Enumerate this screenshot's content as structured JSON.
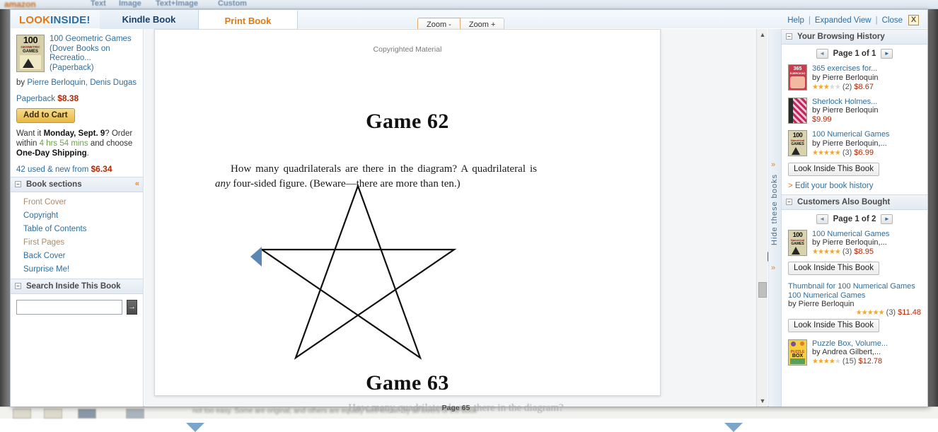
{
  "background": {
    "logo": "amazon",
    "nav": [
      "Text",
      "Image",
      "Text+Image",
      "Custom"
    ],
    "bottom_faded_text": "not too easy. Some are original, and others are equally well-known by all lovers of the book",
    "faded_page_text": "How many quadrilaterals are there in the diagram?"
  },
  "header": {
    "brand_look": "LOOK",
    "brand_inside": "INSIDE!",
    "tabs": [
      {
        "label": "Kindle Book",
        "active": false
      },
      {
        "label": "Print Book",
        "active": true
      }
    ],
    "zoom_out": "Zoom -",
    "zoom_in": "Zoom +",
    "help": "Help",
    "expanded_view": "Expanded View",
    "close": "Close",
    "close_icon": "X",
    "separator": "|"
  },
  "left_sidebar": {
    "book": {
      "cover": {
        "number": "100",
        "subtitle": "GEOMETRIC",
        "word": "GAMES"
      },
      "title": "100 Geometric Games (Dover Books on Recreatio... (Paperback)",
      "by_prefix": "by ",
      "authors": "Pierre Berloquin, Denis Dugas",
      "format": "Paperback",
      "price": "$8.38",
      "add_to_cart": "Add to Cart",
      "want_it_pre": "Want it ",
      "want_it_day": "Monday, Sept. 9",
      "want_it_mid": "? Order within ",
      "want_it_time": "4 hrs 54 mins",
      "want_it_post": " and choose ",
      "want_it_ship": "One-Day Shipping",
      "want_it_end": ".",
      "used_new_text": "42 used & new from ",
      "used_new_price": "$6.34"
    },
    "book_sections": {
      "header": "Book sections",
      "collapse_icon": "–",
      "arrows_icon": "«",
      "items": [
        {
          "label": "Front Cover",
          "dim": true
        },
        {
          "label": "Copyright",
          "dim": false
        },
        {
          "label": "Table of Contents",
          "dim": false
        },
        {
          "label": "First Pages",
          "dim": true
        },
        {
          "label": "Back Cover",
          "dim": false
        },
        {
          "label": "Surprise Me!",
          "dim": false
        }
      ]
    },
    "search_inside": {
      "header": "Search Inside This Book",
      "collapse_icon": "–",
      "value": "",
      "placeholder": "",
      "go_icon": "→"
    }
  },
  "reader": {
    "copyright_notice": "Copyrighted Material",
    "game_top": "Game 62",
    "paragraph_part1": "How many quadrilaterals are there in the diagram? A quadrilateral is ",
    "paragraph_italic": "any",
    "paragraph_part2": " four-sided figure. (Beware—there are more than ten.)",
    "game_bottom": "Game 63",
    "page_label": "Page 65",
    "prev_page_icon": "left-triangle",
    "next_page_icon": "right-triangle",
    "scroll_up_icon": "▲",
    "scroll_down_icon": "▼",
    "figure": {
      "type": "pentagram",
      "description": "Five-pointed star drawn as a single continuous line"
    }
  },
  "rail": {
    "label": "Hide these books",
    "chevron_icon": "»"
  },
  "right_sidebar": {
    "browsing_history": {
      "header": "Your Browsing History",
      "collapse_icon": "–",
      "page_text": "Page 1 of 1",
      "prev_icon": "◄",
      "next_icon": "►",
      "items": [
        {
          "cover": {
            "number": "365",
            "word": "EJERCICIO",
            "bg": "#cf3b4c"
          },
          "name": "365 exercises for...",
          "author": "by Pierre Berloquin",
          "stars_on": 3,
          "stars_off": 2,
          "count": "(2)",
          "price": "$8.67",
          "look_inside": null
        },
        {
          "cover": {
            "number": "",
            "word": "",
            "bg": "#c0265f"
          },
          "name": "Sherlock Holmes...",
          "author": "by Pierre Berloquin",
          "stars_on": 0,
          "stars_off": 0,
          "count": "",
          "price": "$9.99",
          "look_inside": null
        },
        {
          "cover": {
            "number": "100",
            "word": "GAMES",
            "bg": "#d8d2ae"
          },
          "name": "100 Numerical Games",
          "author": "by Pierre Berloquin,...",
          "stars_on": 5,
          "stars_off": 0,
          "count": "(3)",
          "price": "$6.99",
          "look_inside": "Look Inside This Book"
        }
      ],
      "edit_link": "Edit your book history",
      "edit_arrow": ">"
    },
    "customers_also_bought": {
      "header": "Customers Also Bought",
      "collapse_icon": "–",
      "page_text": "Page 1 of 2",
      "prev_icon": "◄",
      "next_icon": "►",
      "items": [
        {
          "cover": {
            "number": "100",
            "word": "GAMES",
            "bg": "#d8d2ae"
          },
          "name": "100 Numerical Games",
          "author": "by Pierre Berloquin,...",
          "stars_on": 5,
          "stars_off": 0,
          "count": "(3)",
          "price": "$8.95",
          "look_inside": "Look Inside This Book"
        }
      ],
      "thumbnail_label": "Thumbnail for 100 Numerical Games",
      "thumb_name": "100 Numerical Games",
      "thumb_author": "by Pierre Berloquin",
      "thumb_stars_on": 5,
      "thumb_count": "(3)",
      "thumb_price": "$11.48",
      "thumb_look_inside": "Look Inside This Book",
      "last_item": {
        "cover": {
          "number": "",
          "word": "BOX",
          "bg": "#f4d03f"
        },
        "name": "Puzzle Box, Volume...",
        "author": "by Andrea Gilbert,...",
        "stars_on": 4,
        "stars_off": 1,
        "count": "(15)",
        "price": "$12.78"
      }
    }
  },
  "colors": {
    "brand_orange": "#e47911",
    "link_blue": "#2e6e9e",
    "price_red": "#b12704",
    "star_gold": "#f5a623"
  }
}
